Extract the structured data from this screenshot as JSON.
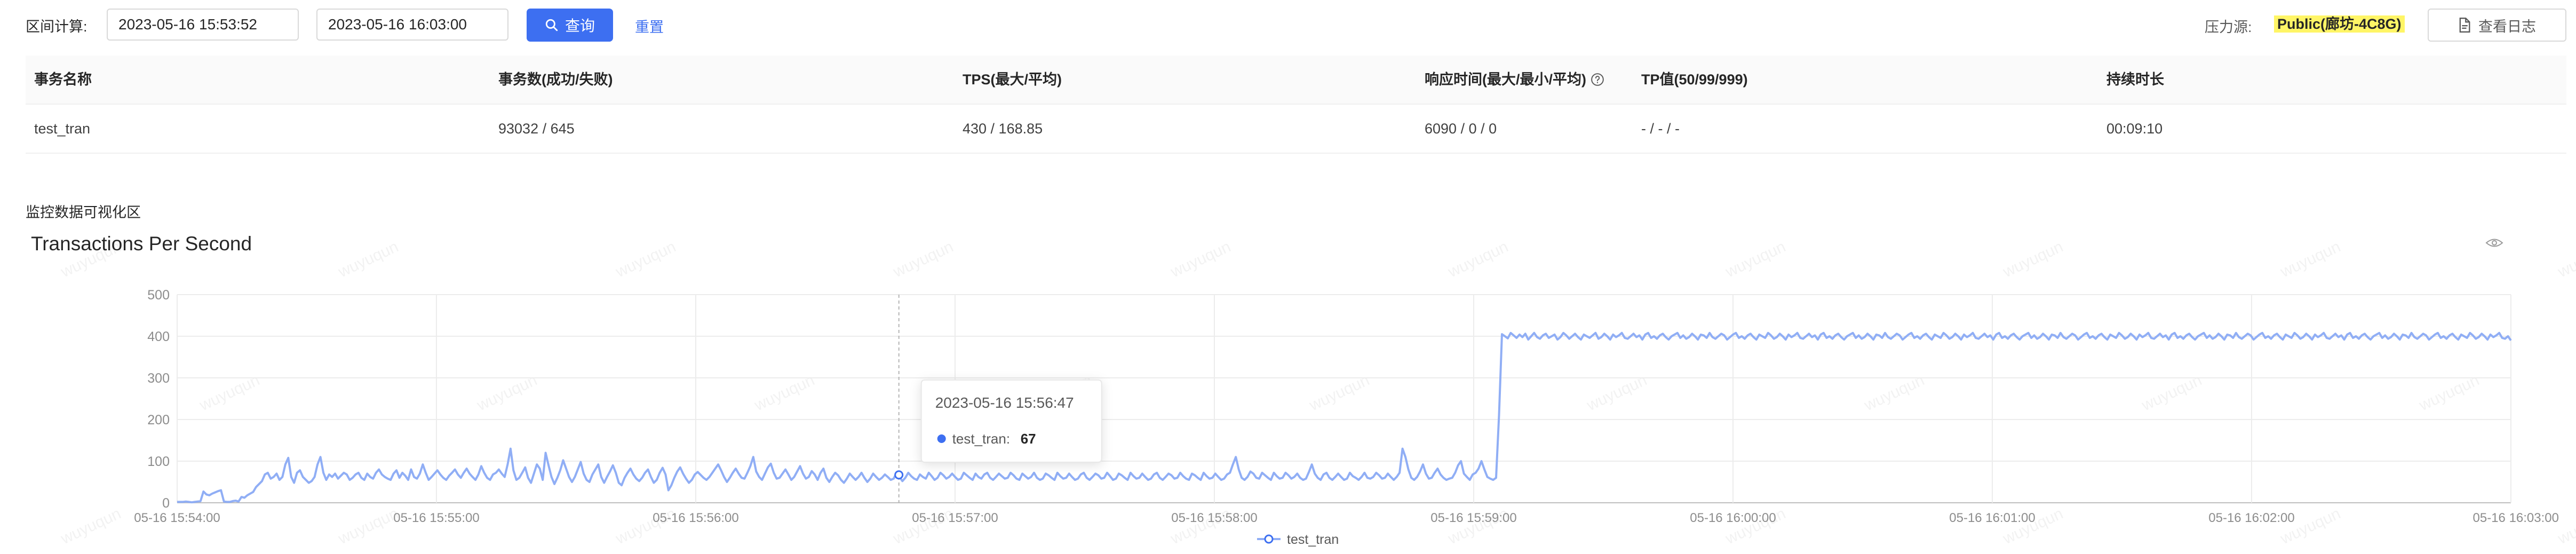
{
  "toolbar": {
    "range_label": "区间计算:",
    "start_time": "2023-05-16 15:53:52",
    "end_time": "2023-05-16 16:03:00",
    "query_label": "查询",
    "reset_label": "重置",
    "source_label": "压力源:",
    "source_value": "Public(廊坊-4C8G)",
    "log_label": "查看日志"
  },
  "table": {
    "headers": [
      "事务名称",
      "事务数(成功/失败)",
      "TPS(最大/平均)",
      "响应时间(最大/最小/平均)",
      "TP值(50/99/999)",
      "持续时长"
    ],
    "rows": [
      [
        "test_tran",
        "93032 / 645",
        "430 / 168.85",
        "6090 / 0 / 0",
        "- / - / -",
        "00:09:10"
      ]
    ]
  },
  "monitor": {
    "section_label": "监控数据可视化区"
  },
  "chart_data": {
    "type": "line",
    "title": "Transactions Per Second",
    "xlabel": "",
    "ylabel": "",
    "ylim": [
      0,
      500
    ],
    "y_ticks": [
      0,
      100,
      200,
      300,
      400,
      500
    ],
    "x_tick_labels": [
      "05-16 15:54:00",
      "05-16 15:55:00",
      "05-16 15:56:00",
      "05-16 15:57:00",
      "05-16 15:58:00",
      "05-16 15:59:00",
      "05-16 16:00:00",
      "05-16 16:01:00",
      "05-16 16:02:00",
      "05-16 16:03:00"
    ],
    "x_range": [
      "05-16 15:54:00",
      "05-16 16:03:00"
    ],
    "grid": true,
    "legend_position": "bottom-center",
    "series": [
      {
        "name": "test_tran",
        "color": "#90aef5",
        "values": [
          2,
          2,
          2,
          3,
          2,
          1,
          2,
          3,
          4,
          27,
          20,
          18,
          22,
          25,
          28,
          30,
          3,
          2,
          2,
          4,
          5,
          3,
          14,
          12,
          18,
          22,
          26,
          38,
          45,
          52,
          68,
          72,
          58,
          62,
          70,
          55,
          62,
          92,
          108,
          62,
          48,
          72,
          78,
          62,
          55,
          48,
          52,
          62,
          92,
          110,
          72,
          55,
          68,
          62,
          70,
          58,
          65,
          72,
          68,
          55,
          60,
          68,
          72,
          60,
          55,
          70,
          62,
          58,
          72,
          80,
          68,
          62,
          58,
          55,
          70,
          78,
          60,
          72,
          65,
          55,
          80,
          62,
          58,
          70,
          92,
          72,
          55,
          62,
          70,
          78,
          68,
          60,
          55,
          65,
          72,
          80,
          68,
          60,
          72,
          82,
          70,
          62,
          55,
          68,
          88,
          72,
          60,
          55,
          68,
          72,
          80,
          70,
          62,
          92,
          130,
          78,
          55,
          60,
          72,
          85,
          60,
          48,
          70,
          92,
          82,
          55,
          120,
          90,
          62,
          45,
          60,
          78,
          102,
          82,
          62,
          50,
          62,
          80,
          98,
          70,
          55,
          50,
          68,
          80,
          92,
          62,
          48,
          62,
          75,
          90,
          72,
          48,
          42,
          60,
          72,
          82,
          68,
          58,
          52,
          60,
          72,
          80,
          62,
          48,
          55,
          72,
          84,
          68,
          30,
          42,
          60,
          75,
          85,
          70,
          58,
          48,
          55,
          68,
          74,
          67,
          60,
          55,
          62,
          72,
          82,
          92,
          78,
          62,
          50,
          60,
          72,
          82,
          70,
          60,
          58,
          72,
          88,
          110,
          75,
          62,
          55,
          70,
          85,
          94,
          72,
          58,
          60,
          70,
          80,
          68,
          55,
          62,
          75,
          88,
          70,
          58,
          62,
          76,
          68,
          55,
          72,
          82,
          60,
          50,
          62,
          72,
          66,
          55,
          48,
          58,
          70,
          62,
          55,
          62,
          72,
          60,
          50,
          58,
          70,
          62,
          55,
          60,
          68,
          62,
          55,
          58,
          72,
          62,
          52,
          60,
          72,
          64,
          58,
          55,
          68,
          62,
          58,
          72,
          64,
          55,
          60,
          72,
          66,
          58,
          62,
          70,
          62,
          55,
          58,
          72,
          66,
          60,
          55,
          70,
          62,
          58,
          68,
          72,
          60,
          55,
          62,
          70,
          64,
          58,
          60,
          72,
          66,
          58,
          55,
          70,
          64,
          58,
          62,
          72,
          60,
          55,
          58,
          70,
          66,
          60,
          55,
          72,
          64,
          58,
          60,
          70,
          62,
          55,
          58,
          68,
          72,
          60,
          55,
          62,
          70,
          66,
          58,
          60,
          72,
          64,
          55,
          58,
          70,
          66,
          60,
          55,
          72,
          64,
          58,
          60,
          70,
          62,
          55,
          58,
          68,
          72,
          60,
          55,
          62,
          70,
          66,
          58,
          60,
          72,
          64,
          58,
          55,
          70,
          66,
          60,
          55,
          72,
          64,
          58,
          60,
          70,
          62,
          55,
          58,
          68,
          72,
          92,
          110,
          80,
          60,
          55,
          62,
          75,
          70,
          60,
          58,
          72,
          66,
          60,
          55,
          72,
          64,
          58,
          60,
          72,
          66,
          58,
          62,
          70,
          60,
          55,
          58,
          74,
          92,
          70,
          60,
          55,
          68,
          72,
          60,
          55,
          62,
          70,
          62,
          55,
          58,
          72,
          64,
          60,
          55,
          62,
          72,
          60,
          58,
          62,
          72,
          66,
          58,
          60,
          70,
          62,
          55,
          62,
          72,
          130,
          110,
          80,
          60,
          55,
          62,
          75,
          92,
          70,
          58,
          60,
          72,
          82,
          68,
          60,
          55,
          58,
          60,
          72,
          90,
          100,
          70,
          62,
          55,
          68,
          72,
          82,
          100,
          80,
          62,
          58,
          55,
          60,
          210,
          405,
          400,
          395,
          408,
          402,
          396,
          404,
          398,
          406,
          392,
          400,
          408,
          398,
          394,
          402,
          406,
          396,
          400,
          404,
          392,
          398,
          408,
          402,
          394,
          400,
          406,
          398,
          392,
          404,
          400,
          396,
          402,
          408,
          394,
          398,
          406,
          400,
          392,
          404,
          398,
          402,
          408,
          396,
          394,
          400,
          406,
          398,
          402,
          392,
          404,
          408,
          396,
          400,
          394,
          402,
          406,
          398,
          392,
          400,
          404,
          408,
          396,
          402,
          394,
          398,
          406,
          400,
          392,
          404,
          402,
          396,
          408,
          398,
          394,
          400,
          406,
          402,
          392,
          398,
          404,
          408,
          396,
          400,
          394,
          402,
          406,
          398,
          392,
          404,
          400,
          396,
          408,
          402,
          394,
          398,
          406,
          400,
          392,
          404,
          398,
          402,
          408,
          396,
          394,
          400,
          406,
          398,
          402,
          392,
          404,
          408,
          396,
          400,
          394,
          402,
          406,
          398,
          392,
          400,
          404,
          408,
          396,
          402,
          394,
          398,
          406,
          400,
          392,
          404,
          402,
          396,
          408,
          398,
          394,
          400,
          406,
          402,
          392,
          398,
          404,
          408,
          396,
          400,
          394,
          402,
          406,
          398,
          392,
          404,
          400,
          396,
          408,
          402,
          394,
          398,
          406,
          400,
          392,
          404,
          398,
          402,
          408,
          396,
          394,
          400,
          406,
          398,
          402,
          392,
          404,
          408,
          396,
          400,
          394,
          402,
          406,
          398,
          392,
          400,
          404,
          408,
          396,
          402,
          394,
          398,
          406,
          400,
          392,
          404,
          402,
          396,
          408,
          398,
          394,
          400,
          406,
          402,
          392,
          398,
          404,
          408,
          396,
          400,
          394,
          402,
          406,
          398,
          392,
          404,
          400,
          396,
          408,
          402,
          394,
          398,
          406,
          400,
          392,
          404,
          398,
          402,
          408,
          396,
          394,
          400,
          406,
          398,
          402,
          392,
          404,
          408,
          396,
          400,
          394,
          402,
          406,
          398,
          392,
          400,
          404,
          408,
          396,
          402,
          394,
          398,
          406,
          400,
          392,
          404,
          402,
          396,
          408,
          398,
          394,
          400,
          406,
          402,
          392,
          398,
          404,
          408,
          396,
          400,
          394,
          402,
          406,
          398,
          392,
          404,
          400,
          396,
          408,
          402,
          394,
          398,
          406,
          400,
          392,
          404,
          398,
          402,
          408,
          396,
          394,
          400,
          406,
          398,
          402,
          392,
          404,
          408,
          396,
          400,
          394,
          402,
          406,
          398,
          392,
          400,
          404,
          408,
          396,
          402,
          394,
          398,
          406,
          400,
          392,
          404,
          402,
          396,
          408,
          398,
          394,
          400,
          406,
          402,
          392,
          398,
          404,
          408,
          396,
          400,
          394,
          402,
          406,
          398,
          392,
          404,
          400,
          396,
          408,
          402,
          394,
          398,
          406,
          400,
          392,
          404,
          398,
          402,
          408,
          396,
          394,
          400,
          390
        ]
      }
    ],
    "tooltip": {
      "time": "2023-05-16 15:56:47",
      "series_name": "test_tran",
      "value": 67,
      "label_text": "test_tran:"
    },
    "watermark": "wuyuqun"
  }
}
